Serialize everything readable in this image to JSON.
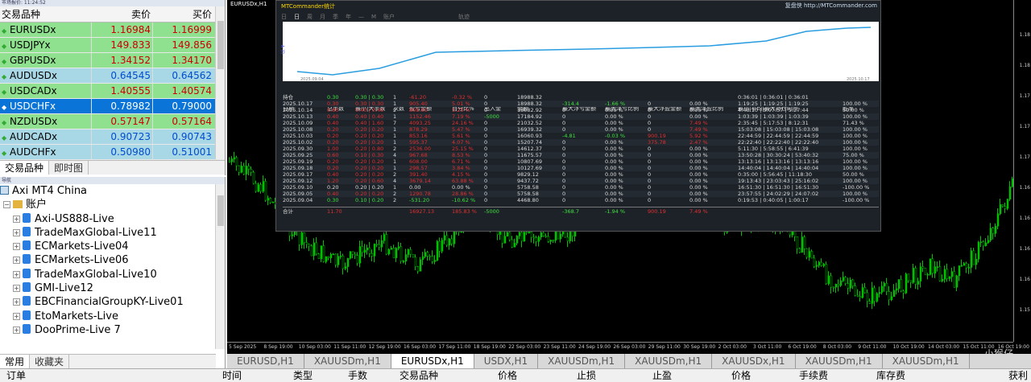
{
  "market_watch": {
    "caption": "市场报价: 11:24:52",
    "col_symbol": "交易品种",
    "col_bid": "卖价",
    "col_ask": "买价",
    "rows": [
      {
        "symbol": "EURUSDx",
        "bid": "1.16984",
        "ask": "1.16999",
        "state": "up"
      },
      {
        "symbol": "USDJPYx",
        "bid": "149.833",
        "ask": "149.856",
        "state": "up"
      },
      {
        "symbol": "GBPUSDx",
        "bid": "1.34152",
        "ask": "1.34170",
        "state": "up"
      },
      {
        "symbol": "AUDUSDx",
        "bid": "0.64545",
        "ask": "0.64562",
        "state": "dn"
      },
      {
        "symbol": "USDCADx",
        "bid": "1.40555",
        "ask": "1.40574",
        "state": "up"
      },
      {
        "symbol": "USDCHFx",
        "bid": "0.78982",
        "ask": "0.79000",
        "state": "sel"
      },
      {
        "symbol": "NZDUSDx",
        "bid": "0.57147",
        "ask": "0.57164",
        "state": "up"
      },
      {
        "symbol": "AUDCADx",
        "bid": "0.90723",
        "ask": "0.90743",
        "state": "dn"
      },
      {
        "symbol": "AUDCHFx",
        "bid": "0.50980",
        "ask": "0.51001",
        "state": "dn"
      }
    ],
    "tabs": [
      "交易品种",
      "即时图"
    ]
  },
  "navigator": {
    "caption": "导航",
    "root": "Axi MT4 China",
    "folder": "账户",
    "accounts": [
      "Axi-US888-Live",
      "TradeMaxGlobal-Live11",
      "ECMarkets-Live04",
      "ECMarkets-Live06",
      "TradeMaxGlobal-Live10",
      "GMI-Live12",
      "EBCFinancialGroupKY-Live01",
      "EtoMarkets-Live",
      "DooPrime-Live 7"
    ],
    "tabs": [
      "常用",
      "收藏夹"
    ]
  },
  "chart": {
    "title": "EURUSDx,H1",
    "price_scale": [
      "1.18",
      "1.18",
      "1.17",
      "1.17",
      "1.17",
      "1.16",
      "1.16",
      "1.16",
      "1.16",
      "1.15"
    ],
    "time_scale": [
      "5 Sep 2025",
      "8 Sep 19:00",
      "10 Sep 03:00",
      "11 Sep 11:00",
      "12 Sep 19:00",
      "16 Sep 03:00",
      "17 Sep 11:00",
      "18 Sep 19:00",
      "22 Sep 03:00",
      "23 Sep 11:00",
      "24 Sep 19:00",
      "26 Sep 03:00",
      "29 Sep 11:00",
      "30 Sep 19:00",
      "2 Oct 03:00",
      "3 Oct 11:00",
      "6 Oct 19:00",
      "8 Oct 03:00",
      "9 Oct 11:00",
      "10 Oct 19:00",
      "14 Oct 03:00",
      "15 Oct 11:00",
      "16 Oct 19:00"
    ],
    "tabs": [
      "EURUSD,H1",
      "XAUUSDm,H1",
      "EURUSDx,H1",
      "USDX,H1",
      "XAUUSDm,H1",
      "XAUUSDm,H1",
      "XAUUSDx,H1",
      "XAUUSDm,H1",
      "XAUUSDm,H1"
    ],
    "active_tab": 2
  },
  "stats": {
    "title": "MTCommander统计",
    "link": "复盘侠 http://MTCommander.com",
    "periods": [
      "日",
      "日",
      "周",
      "月",
      "季",
      "年",
      "—",
      "M",
      "账户",
      "轨迹"
    ],
    "curve": {
      "ylabel": "以 ¥",
      "x_start": "2025.09.04",
      "x_end": "2025.10.17"
    },
    "headers": [
      "日期",
      "总手数",
      "最小|大手数",
      "次数",
      "盈亏金额",
      "百分比%",
      "出入金",
      "余额",
      "最大浮亏金额",
      "最大浮亏比例",
      "最大浮盈金额",
      "最大浮盈比例",
      "最小|平均|最大持仓时间",
      "胜率"
    ],
    "rows": [
      {
        "c": [
          "持仓",
          "0.30",
          "0.30 | 0.30",
          "1",
          "-61.20",
          "-0.32 %",
          "0",
          "18988.32",
          "",
          "",
          "",
          "",
          "0:36:01 | 0:36:01 | 0:36:01",
          ""
        ],
        "k": [
          "g",
          "g",
          "",
          "r",
          "r",
          "",
          "",
          "",
          "",
          "",
          "",
          "",
          ""
        ]
      },
      {
        "c": [
          "2025.10.17",
          "0.30",
          "0.30 | 0.30",
          "1",
          "905.40",
          "5.01 %",
          "0",
          "18988.32",
          "-314.4",
          "-1.66 %",
          "0",
          "0.00 %",
          "1:19:25 | 1:19:25 | 1:19:25",
          "100.00 %"
        ],
        "k": [
          "r",
          "r",
          "",
          "r",
          "r",
          "",
          "",
          "g",
          "g",
          "",
          "",
          "",
          "",
          ""
        ]
      },
      {
        "c": [
          "2025.10.14",
          "0.80",
          "0.40 | 0.40",
          "2",
          "808.00",
          "5.25 %",
          "0",
          "18082.92",
          "0",
          "0.00 %",
          "0",
          "0.00 %",
          "4:48:10 | 5:07:57 | 5:27:44",
          "50.00 %"
        ],
        "k": [
          "r",
          "r",
          "",
          "r",
          "r",
          "",
          "",
          "",
          "",
          "",
          "",
          "",
          "",
          ""
        ]
      },
      {
        "c": [
          "2025.10.13",
          "0.40",
          "0.40 | 0.40",
          "1",
          "1152.46",
          "7.19 %",
          "-5000",
          "17184.92",
          "0",
          "0.00 %",
          "0",
          "0.00 %",
          "1:03:39 | 1:03:39 | 1:03:39",
          "100.00 %"
        ],
        "k": [
          "r",
          "r",
          "",
          "r",
          "r",
          "g",
          "",
          "",
          "",
          "",
          "",
          "",
          "",
          ""
        ]
      },
      {
        "c": [
          "2025.10.09",
          "0.40",
          "0.40 | 1.60",
          "7",
          "4093.25",
          "24.16 %",
          "0",
          "21032.52",
          "0",
          "0.00 %",
          "0",
          "7.49 %",
          "2:35:45 | 5:17:53 | 8:12:31",
          "71.43 %"
        ],
        "k": [
          "r",
          "r",
          "",
          "r",
          "r",
          "",
          "",
          "",
          "",
          "",
          "r",
          "",
          "",
          ""
        ]
      },
      {
        "c": [
          "2025.10.08",
          "0.20",
          "0.20 | 0.20",
          "1",
          "878.29",
          "5.47 %",
          "0",
          "16939.32",
          "0",
          "0.00 %",
          "0",
          "7.49 %",
          "15:03:08 | 15:03:08 | 15:03:08",
          "100.00 %"
        ],
        "k": [
          "r",
          "r",
          "",
          "r",
          "r",
          "",
          "",
          "",
          "",
          "",
          "r",
          "",
          "",
          ""
        ]
      },
      {
        "c": [
          "2025.10.03",
          "0.20",
          "0.20 | 0.20",
          "1",
          "853.16",
          "5.61 %",
          "0",
          "16060.93",
          "-4.81",
          "-0.03 %",
          "900.19",
          "5.92 %",
          "22:44:59 | 22:44:59 | 22:44:59",
          "100.00 %"
        ],
        "k": [
          "r",
          "r",
          "",
          "r",
          "r",
          "",
          "",
          "g",
          "g",
          "r",
          "r",
          "",
          "",
          ""
        ]
      },
      {
        "c": [
          "2025.10.02",
          "0.20",
          "0.20 | 0.20",
          "1",
          "595.37",
          "4.07 %",
          "0",
          "15207.74",
          "0",
          "0.00 %",
          "375.78",
          "2.47 %",
          "22:22:40 | 22:22:40 | 22:22:40",
          "100.00 %"
        ],
        "k": [
          "r",
          "r",
          "",
          "r",
          "r",
          "",
          "",
          "",
          "",
          "r",
          "r",
          "",
          "",
          ""
        ]
      },
      {
        "c": [
          "2025.09.30",
          "1.00",
          "0.20 | 0.80",
          "2",
          "2536.00",
          "25.15 %",
          "0",
          "14612.37",
          "0",
          "0.00 %",
          "0",
          "0.00 %",
          "5:11:30 | 5:58:55 | 6:41:39",
          "100.00 %"
        ],
        "k": [
          "r",
          "r",
          "",
          "r",
          "r",
          "",
          "",
          "",
          "",
          "",
          "",
          "",
          "",
          ""
        ]
      },
      {
        "c": [
          "2025.09.25",
          "0.60",
          "0.10 | 0.30",
          "4",
          "967.68",
          "8.53 %",
          "0",
          "11675.57",
          "0",
          "0.00 %",
          "0",
          "0.00 %",
          "13:50:28 | 30:30:24 | 53:40:32",
          "75.00 %"
        ],
        "k": [
          "r",
          "r",
          "",
          "r",
          "r",
          "",
          "",
          "",
          "",
          "",
          "",
          "",
          "",
          ""
        ]
      },
      {
        "c": [
          "2025.09.19",
          "0.20",
          "0.20 | 0.20",
          "1",
          "608.00",
          "6.71 %",
          "0",
          "10807.69",
          "0",
          "0.00 %",
          "0",
          "0.00 %",
          "13:13:16 | 13:13:16 | 13:13:16",
          "100.00 %"
        ],
        "k": [
          "r",
          "r",
          "",
          "r",
          "r",
          "",
          "",
          "",
          "",
          "",
          "",
          "",
          "",
          ""
        ]
      },
      {
        "c": [
          "2025.09.18",
          "0.20",
          "0.20 | 0.20",
          "1",
          "298.57",
          "3.84 %",
          "0",
          "10127.69",
          "0",
          "0.00 %",
          "0",
          "0.00 %",
          "14:40:04 | 14:40:04 | 14:40:04",
          "100.00 %"
        ],
        "k": [
          "r",
          "r",
          "",
          "r",
          "r",
          "",
          "",
          "",
          "",
          "",
          "",
          "",
          "",
          ""
        ]
      },
      {
        "c": [
          "2025.09.17",
          "0.40",
          "0.20 | 0.20",
          "2",
          "391.40",
          "4.15 %",
          "0",
          "9829.12",
          "0",
          "0.00 %",
          "0",
          "0.00 %",
          "0:35:00 | 5:56:45 | 11:18:30",
          "50.00 %"
        ],
        "k": [
          "r",
          "r",
          "",
          "r",
          "r",
          "",
          "",
          "",
          "",
          "",
          "",
          "",
          "",
          ""
        ]
      },
      {
        "c": [
          "2025.09.12",
          "1.20",
          "0.20 | 0.60",
          "4",
          "3679.14",
          "63.88 %",
          "0",
          "9437.72",
          "0",
          "0.00 %",
          "0",
          "0.00 %",
          "19:13:43 | 23:03:43 | 25:16:02",
          "100.00 %"
        ],
        "k": [
          "r",
          "r",
          "",
          "r",
          "r",
          "",
          "",
          "",
          "",
          "",
          "",
          "",
          "",
          ""
        ]
      },
      {
        "c": [
          "2025.09.10",
          "0.20",
          "0.20 | 0.20",
          "1",
          "0.00",
          "0.00 %",
          "0",
          "5758.58",
          "0",
          "0.00 %",
          "0",
          "0.00 %",
          "16:51:30 | 16:51:30 | 16:51:30",
          "-100.00 %"
        ],
        "k": [
          "",
          "",
          "",
          "",
          "",
          "",
          "",
          "",
          "",
          "",
          "",
          "",
          "",
          ""
        ]
      },
      {
        "c": [
          "2025.09.05",
          "0.40",
          "0.20 | 0.20",
          "2",
          "1290.78",
          "28.86 %",
          "0",
          "5758.58",
          "0",
          "0.00 %",
          "0",
          "0.00 %",
          "23:57:55 | 24:02:29 | 24:07:02",
          "100.00 %"
        ],
        "k": [
          "r",
          "r",
          "",
          "r",
          "r",
          "",
          "",
          "",
          "",
          "",
          "",
          "",
          "",
          ""
        ]
      },
      {
        "c": [
          "2025.09.04",
          "0.30",
          "0.10 | 0.20",
          "2",
          "-531.20",
          "-10.62 %",
          "0",
          "4468.80",
          "0",
          "0.00 %",
          "0",
          "0.00 %",
          "0:19:53 | 0:40:05 | 1:00:17",
          "-100.00 %"
        ],
        "k": [
          "g",
          "g",
          "",
          "g",
          "g",
          "",
          "",
          "",
          "",
          "",
          "",
          "",
          "",
          ""
        ]
      }
    ],
    "total": {
      "label": "合计",
      "lots": "11.70",
      "pnl": "16927.13",
      "pct": "185.83 %",
      "io": "-5000",
      "maxloss": "-368.7",
      "maxlosspct": "-1.94 %",
      "maxprofit": "900.19",
      "maxprofitpct": "7.49 %"
    }
  },
  "bottom": {
    "columns": [
      "订单",
      "时间",
      "类型",
      "手数",
      "交易品种",
      "价格",
      "止损",
      "止盈",
      "价格",
      "手续费",
      "库存费",
      "获利"
    ]
  },
  "watermark": "小猴仔"
}
